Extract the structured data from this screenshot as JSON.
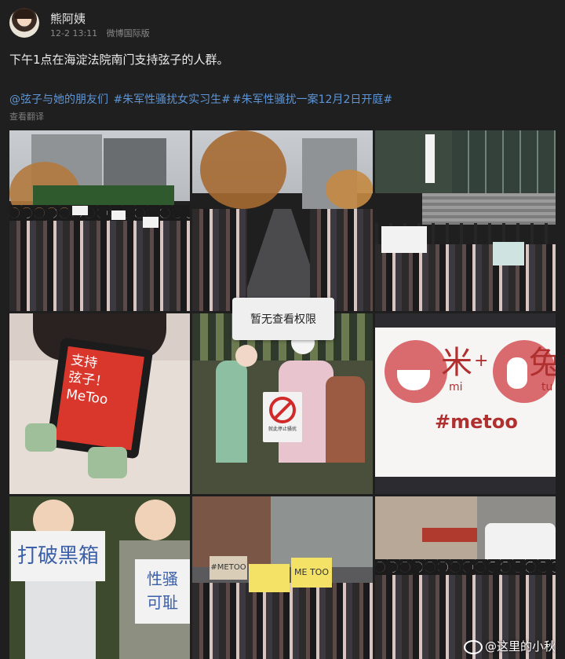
{
  "post": {
    "username": "熊阿姨",
    "time": "12-2 13:11",
    "source": "微博国际版",
    "text": "下午1点在海淀法院南门支持弦子的人群。",
    "tags": [
      "@弦子与她的朋友们",
      "#朱军性骚扰女实习生#",
      "#朱军性骚扰一案12月2日开庭#"
    ],
    "translate_label": "查看翻译"
  },
  "images": {
    "toast": "暂无查看权限",
    "sign_tablet": "支持\n弦子！\nMeToo",
    "sign_metoo": "#metoo",
    "sign_mi": "mi",
    "sign_tu": "tu",
    "sign_plus": "+",
    "sign_char_mi": "米",
    "sign_char_tu": "兔",
    "sign_break": "打破黑箱",
    "sign_xingsao": "性骚\n可耻",
    "sign_stop": "就此停止骚扰",
    "sign_metoo_yellow": "ME TOO",
    "sign_metoo_cap": "#METOO"
  },
  "watermark": "@这里的小秋"
}
